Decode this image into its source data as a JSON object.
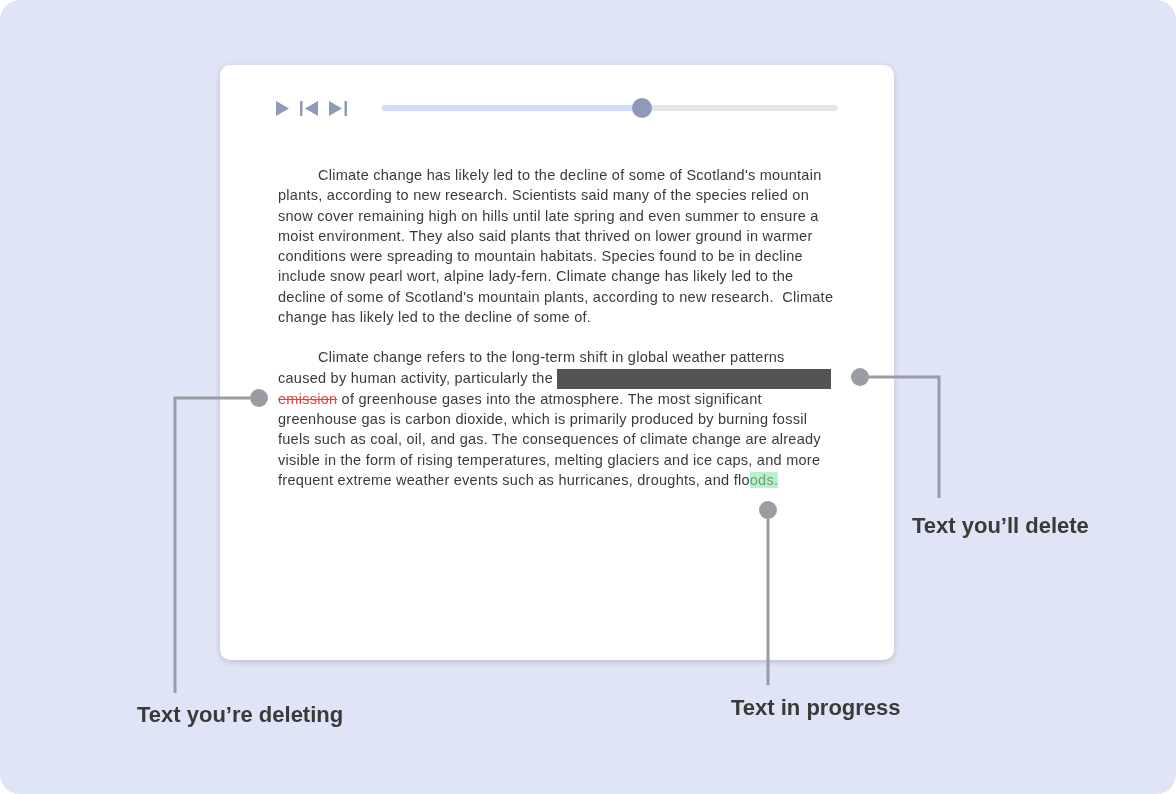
{
  "player": {
    "progress": {
      "level": 0.57
    }
  },
  "document": {
    "paragraphs": [
      {
        "segments": [
          {
            "kind": "text",
            "text": "Climate change has likely led to the decline of some of Scotland's mountain plants, according to new research. Scientists said many of the species relied on snow cover remaining high on hills until late spring and even summer to ensure a moist environment. They also said plants that thrived on lower ground in warmer conditions were spreading to mountain habitats. Species found to be in decline include snow pearl wort, alpine lady-fern. Climate change has likely led to the decline of some of Scotland's mountain plants, according to new research.  Climate change has likely led to the decline of some of."
          }
        ]
      },
      {
        "segments": [
          {
            "kind": "text",
            "text": "Climate change refers to the long-term shift in global weather patterns caused by human activity, particularly the "
          },
          {
            "kind": "redacted"
          },
          {
            "kind": "deleting",
            "text": "emission"
          },
          {
            "kind": "text",
            "text": " of greenhouse gases into the atmosphere. The most significant greenhouse gas is carbon dioxide, which is primarily produced by burning fossil fuels such as coal, oil, and gas. The consequences of climate change are already visible in the form of rising temperatures, melting glaciers and ice caps, and more frequent extreme weather events such as hurricanes, droughts, and flo"
          },
          {
            "kind": "in_progress",
            "text": "ods."
          }
        ]
      }
    ]
  },
  "callouts": [
    {
      "kind": "redacted",
      "label": "Text you’ll delete"
    },
    {
      "kind": "deleting",
      "label": "Text you’re deleting"
    },
    {
      "kind": "in_progress",
      "label": "Text in progress"
    }
  ]
}
